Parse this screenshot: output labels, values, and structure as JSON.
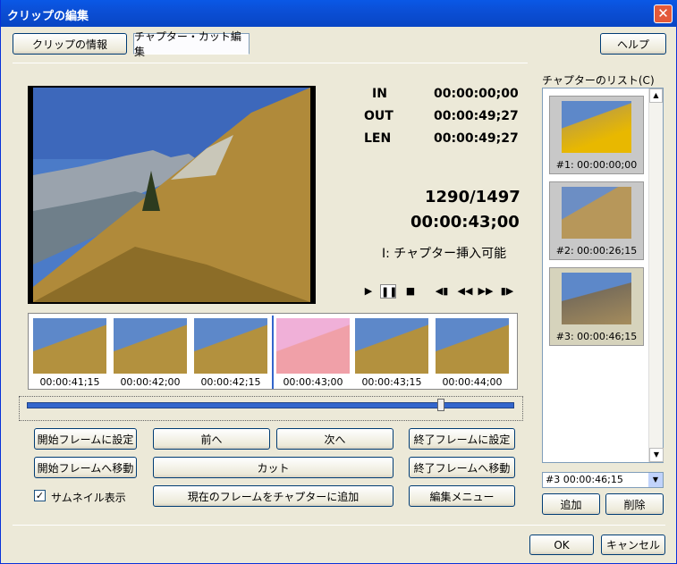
{
  "window": {
    "title": "クリップの編集",
    "close": "✕"
  },
  "tabs": [
    {
      "label": "クリップの情報"
    },
    {
      "label": "チャプター・カット編集"
    }
  ],
  "help_label": "ヘルプ",
  "timecodes": {
    "in_label": "IN",
    "in": "00:00:00;00",
    "out_label": "OUT",
    "out": "00:00:49;27",
    "len_label": "LEN",
    "len": "00:00:49;27"
  },
  "frame_counter": "1290/1497",
  "current_time": "00:00:43;00",
  "status": "I: チャプター挿入可能",
  "thumbnails": [
    {
      "time": "00:00:41;15"
    },
    {
      "time": "00:00:42;00"
    },
    {
      "time": "00:00:42;15"
    },
    {
      "time": "00:00:43;00"
    },
    {
      "time": "00:00:43;15"
    },
    {
      "time": "00:00:44;00"
    }
  ],
  "slider_position": 0.85,
  "buttons": {
    "set_start": "開始フレームに設定",
    "prev": "前へ",
    "next": "次へ",
    "set_end": "終了フレームに設定",
    "goto_start": "開始フレームへ移動",
    "cut": "カット",
    "goto_end": "終了フレームへ移動",
    "add_chapter": "現在のフレームをチャプターに追加",
    "edit_menu": "編集メニュー",
    "add": "追加",
    "delete": "削除",
    "ok": "OK",
    "cancel": "キャンセル"
  },
  "thumbnail_checkbox": {
    "label": "サムネイル表示",
    "checked": true
  },
  "chapter_list": {
    "title": "チャプターのリスト(C)",
    "items": [
      {
        "label": "#1: 00:00:00;00"
      },
      {
        "label": "#2: 00:00:26;15"
      },
      {
        "label": "#3: 00:00:46;15"
      }
    ],
    "selected": "#3    00:00:46;15"
  },
  "colors": {
    "title_bar": "#0b4fd6",
    "slider": "#3366cc",
    "selection": "#d6d3bc"
  }
}
